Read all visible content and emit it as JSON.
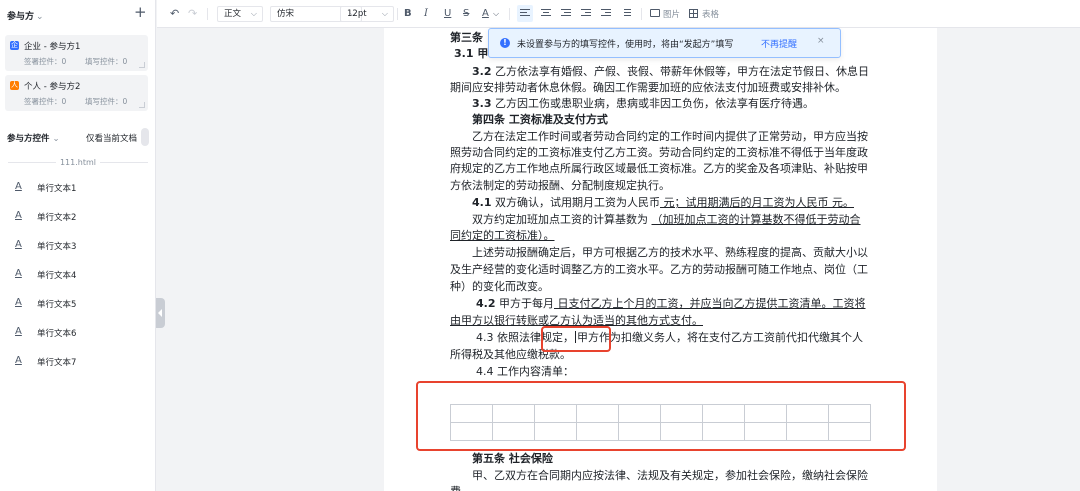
{
  "left_panel": {
    "header": "参与方",
    "parties": [
      {
        "name": "企业 - 参与方1",
        "icon": "enterprise-icon",
        "icon_color": "#3370ff",
        "stat_fill": "签署控件：0",
        "stat_write": "填写控件：0"
      },
      {
        "name": "个人 - 参与方2",
        "icon": "person-icon",
        "icon_color": "#ff7d00",
        "stat_fill": "签署控件：0",
        "stat_write": "填写控件：0"
      }
    ],
    "controls_header": "参与方控件",
    "only_current_doc": "仅看当前文档",
    "file_name": "111.html",
    "controls": [
      "单行文本1",
      "单行文本2",
      "单行文本3",
      "单行文本4",
      "单行文本5",
      "单行文本6",
      "单行文本7"
    ]
  },
  "toolbar": {
    "style_select": "正文",
    "font_select": "仿宋",
    "size_select": "12pt",
    "bold": "B",
    "italic": "I",
    "underline": "U",
    "strike": "S",
    "font_color": "A",
    "image_label": "图片",
    "table_label": "表格"
  },
  "notice": {
    "message": "未设置参与方的填写控件，使用时，将由“发起方”填写",
    "dismiss_link": "不再提醒",
    "close": "×"
  },
  "doc": {
    "l1": "第三条",
    "l2": "3.1 甲",
    "l3a": "3.2",
    "l3b": " 乙方依法享有婚假、产假、丧假、带薪年休假等，甲方在法定节假日、休息日",
    "l4": "期间应安排劳动者休息休假。确因工作需要加班的应依法支付加班费或安排补休。",
    "l5a": "3.3",
    "l5b": " 乙方因工伤或患职业病，患病或非因工负伤，依法享有医疗待遇。",
    "l6": "第四条 工资标准及支付方式",
    "l7": "乙方在法定工作时间或者劳动合同约定的工作时间内提供了正常劳动，甲方应当按",
    "l8": "照劳动合同约定的工资标准支付乙方工资。劳动合同约定的工资标准不得低于当年度政",
    "l9": "府规定的乙方工作地点所属行政区域最低工资标准。乙方的奖金及各项津贴、补贴按甲",
    "l10": "方依法制定的劳动报酬、分配制度规定执行。",
    "l11a": "4.1",
    "l11b": " 双方确认，试用期月工资为人民币",
    "l11c": " 元；试用期满后的月工资为人民币 元。",
    "l12a": "双方约定加班加点工资的计算基数为 ",
    "l12b": "（加班加点工资的计算基数不得低于劳动合",
    "l13": "同约定的工资标准）。",
    "l14": "上述劳动报酬确定后，甲方可根据乙方的技术水平、熟练程度的提高、贡献大小以",
    "l15": "及生产经营的变化适时调整乙方的工资水平。乙方的劳动报酬可随工作地点、岗位（工",
    "l16": "种）的变化而改变。",
    "l17a": "4.2",
    "l17b": " 甲方于每月",
    "l17c": " 日支付乙方上个月的工资，并应当向乙方提供工资清单。工资将",
    "l18": "由甲方以银行转账或乙方认为适当的其他方式支付。",
    "l19a": "4.3 依照法律规定，",
    "l19b": "甲方作",
    "l19c": "为扣缴义务人，将在支付乙方工资前代扣代缴其个人",
    "l20": "所得税及其他应缴税款。",
    "l21": "4.4 工作内容清单：",
    "l22": "第五条 社会保险",
    "l23": "甲、乙双方在合同期内应按法律、法规及有关规定，参加社会保险，缴纳社会保险",
    "l24": "费"
  },
  "table": {
    "rows": 2,
    "cols": 10
  },
  "highlight_color": "#e8432e"
}
